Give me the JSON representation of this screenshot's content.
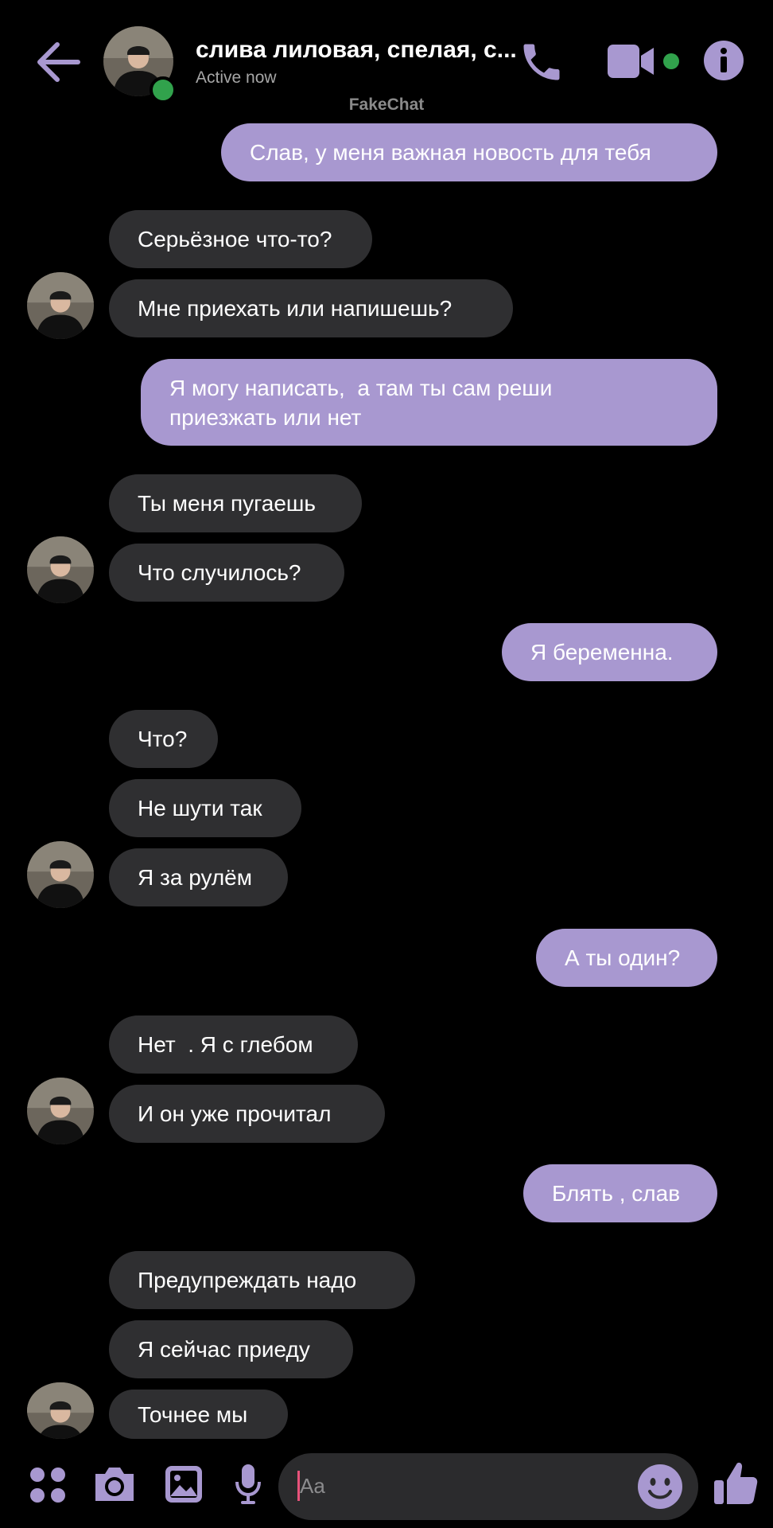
{
  "header": {
    "contact_name": "слива лиловая, спелая, с...",
    "status": "Active now",
    "watermark": "FakeChat"
  },
  "colors": {
    "accent": "#a898d0",
    "incoming_bubble": "#2f2f31",
    "online": "#31a24c",
    "background": "#000000"
  },
  "icons": [
    "back-arrow-icon",
    "phone-icon",
    "video-camera-icon",
    "info-icon",
    "apps-grid-icon",
    "camera-icon",
    "gallery-icon",
    "microphone-icon",
    "emoji-icon",
    "thumbs-up-icon"
  ],
  "messages": [
    {
      "from": "me",
      "text": "Слав, у меня важная новость для тебя"
    },
    {
      "from": "them",
      "text": "Серьёзное что-то?"
    },
    {
      "from": "them",
      "text": "Мне приехать или напишешь?"
    },
    {
      "from": "me",
      "text": "Я могу написать,  а там ты сам реши\nприезжать или нет"
    },
    {
      "from": "them",
      "text": "Ты меня пугаешь"
    },
    {
      "from": "them",
      "text": "Что случилось?"
    },
    {
      "from": "me",
      "text": "Я беременна."
    },
    {
      "from": "them",
      "text": "Что?"
    },
    {
      "from": "them",
      "text": "Не шути так"
    },
    {
      "from": "them",
      "text": "Я за рулём"
    },
    {
      "from": "me",
      "text": "А ты один?"
    },
    {
      "from": "them",
      "text": "Нет  . Я с глебом"
    },
    {
      "from": "them",
      "text": "И он уже прочитал"
    },
    {
      "from": "me",
      "text": "Блять , слав"
    },
    {
      "from": "them",
      "text": "Предупреждать надо"
    },
    {
      "from": "them",
      "text": "Я сейчас приеду"
    },
    {
      "from": "them",
      "text": "Точнее мы"
    }
  ],
  "composer": {
    "placeholder": "Aa"
  }
}
